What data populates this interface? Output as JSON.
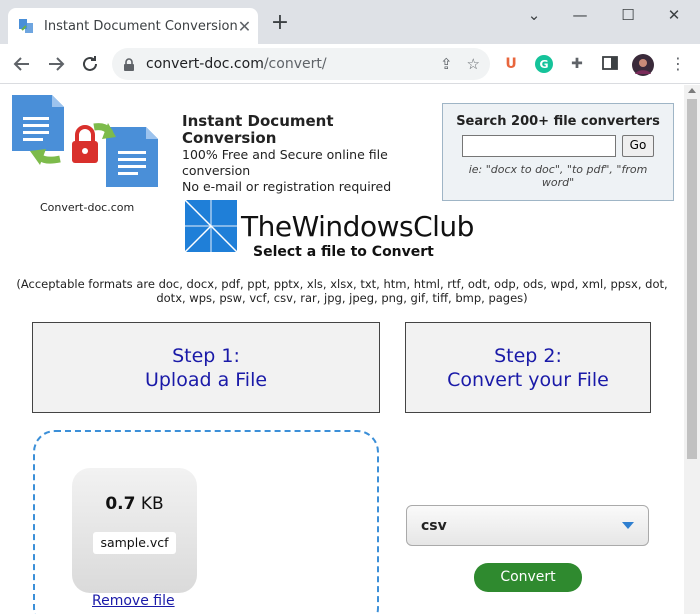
{
  "browser": {
    "tab_title": "Instant Document Conversion",
    "tab_close": "✕",
    "new_tab": "+",
    "url_host": "convert-doc.com",
    "url_path": "/convert/",
    "window_controls": {
      "minimize": "—",
      "maximize": "☐",
      "close": "✕",
      "collapse": "⌄"
    }
  },
  "header": {
    "logo_caption": "Convert-doc.com",
    "site_title": "Instant Document Conversion",
    "tagline_1": "100% Free and Secure online file conversion",
    "tagline_2": "No e-mail or registration required"
  },
  "search": {
    "heading": "Search 200+ file converters",
    "input_value": "",
    "go_label": "Go",
    "hint": "ie: \"docx to doc\", \"to pdf\", \"from word\""
  },
  "watermark": {
    "text": "TheWindowsClub"
  },
  "main": {
    "select_title": "Select a file to Convert",
    "formats_note": "(Acceptable formats are doc, docx, pdf, ppt, pptx, xls, xlsx, txt, htm, html, rtf, odt, odp, ods, wpd, xml, ppsx, dot, dotx, wps, psw, vcf, csv, rar, jpg, jpeg, png, gif, tiff, bmp, pages)",
    "step1_line1": "Step 1:",
    "step1_line2": "Upload a File",
    "step2_line1": "Step 2:",
    "step2_line2": "Convert your File",
    "file_size_value": "0.7",
    "file_size_unit": "KB",
    "file_name": "sample.vcf",
    "remove_label": "Remove file",
    "target_format": "csv",
    "convert_label": "Convert"
  },
  "colors": {
    "link_blue": "#1a1aa8",
    "dropzone_border": "#3b8fd8",
    "convert_green": "#2f8a2f"
  }
}
